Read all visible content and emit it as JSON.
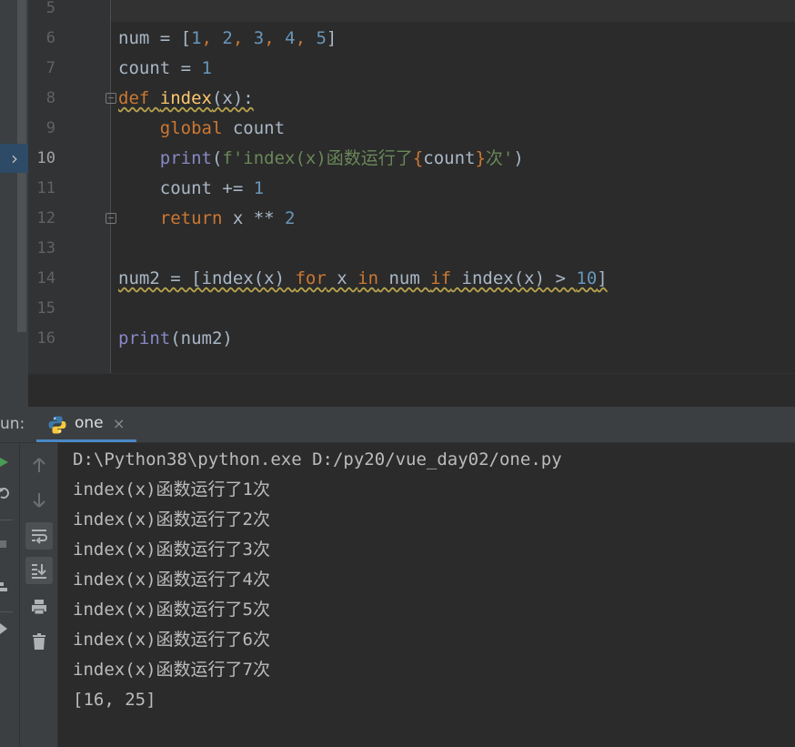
{
  "editor": {
    "line_numbers": [
      "5",
      "6",
      "7",
      "8",
      "9",
      "10",
      "11",
      "12",
      "13",
      "14",
      "15",
      "16"
    ],
    "current_line": "10",
    "lines": {
      "l6": {
        "a": "num = [",
        "n1": "1",
        "c1": ", ",
        "n2": "2",
        "c2": ", ",
        "n3": "3",
        "c3": ", ",
        "n4": "4",
        "c4": ", ",
        "n5": "5",
        "b": "]"
      },
      "l7": {
        "a": "count = ",
        "n": "1"
      },
      "l8": {
        "kw": "def",
        "sp": " ",
        "fn": "index",
        "rest": "(x):"
      },
      "l9": {
        "ind": "    ",
        "kw": "global",
        "rest": " count"
      },
      "l10": {
        "ind": "    ",
        "bi": "print",
        "p1": "(",
        "s1": "f'index(x)函数运行了",
        "lb": "{",
        "v": "count",
        "rb": "}",
        "s2": "次'",
        "p2": ")"
      },
      "l11": {
        "ind": "    ",
        "a": "count += ",
        "n": "1"
      },
      "l12": {
        "ind": "    ",
        "kw": "return",
        "a": " x ** ",
        "n": "2"
      },
      "l14": {
        "a": "num2 = [index(x) ",
        "k1": "for",
        "b": " x ",
        "k2": "in",
        "c": " num ",
        "k3": "if",
        "d": " index(x) > ",
        "n": "10",
        "e": "]"
      },
      "l16": {
        "bi": "print",
        "a": "(num2)"
      }
    }
  },
  "run": {
    "label": "un:",
    "tab_name": "one",
    "tab_close": "×",
    "console_lines": [
      "D:\\Python38\\python.exe D:/py20/vue_day02/one.py",
      "index(x)函数运行了1次",
      "index(x)函数运行了2次",
      "index(x)函数运行了3次",
      "index(x)函数运行了4次",
      "index(x)函数运行了5次",
      "index(x)函数运行了6次",
      "index(x)函数运行了7次",
      "[16, 25]"
    ]
  },
  "colors": {
    "background": "#2b2b2b",
    "keyword": "#cc7832",
    "number": "#6897bb",
    "function": "#ffc66d",
    "builtin": "#8888c6",
    "string": "#6a8759",
    "text": "#a9b7c6",
    "tab_underline": "#4a88c7"
  },
  "icons": [
    "chevron-right-icon",
    "fold-icon",
    "python-icon",
    "close-icon",
    "run-icon",
    "rerun-icon",
    "stop-icon",
    "layout-icon",
    "pin-icon",
    "arrow-up-icon",
    "arrow-down-icon",
    "soft-wrap-icon",
    "scroll-to-end-icon",
    "print-icon",
    "trash-icon"
  ]
}
